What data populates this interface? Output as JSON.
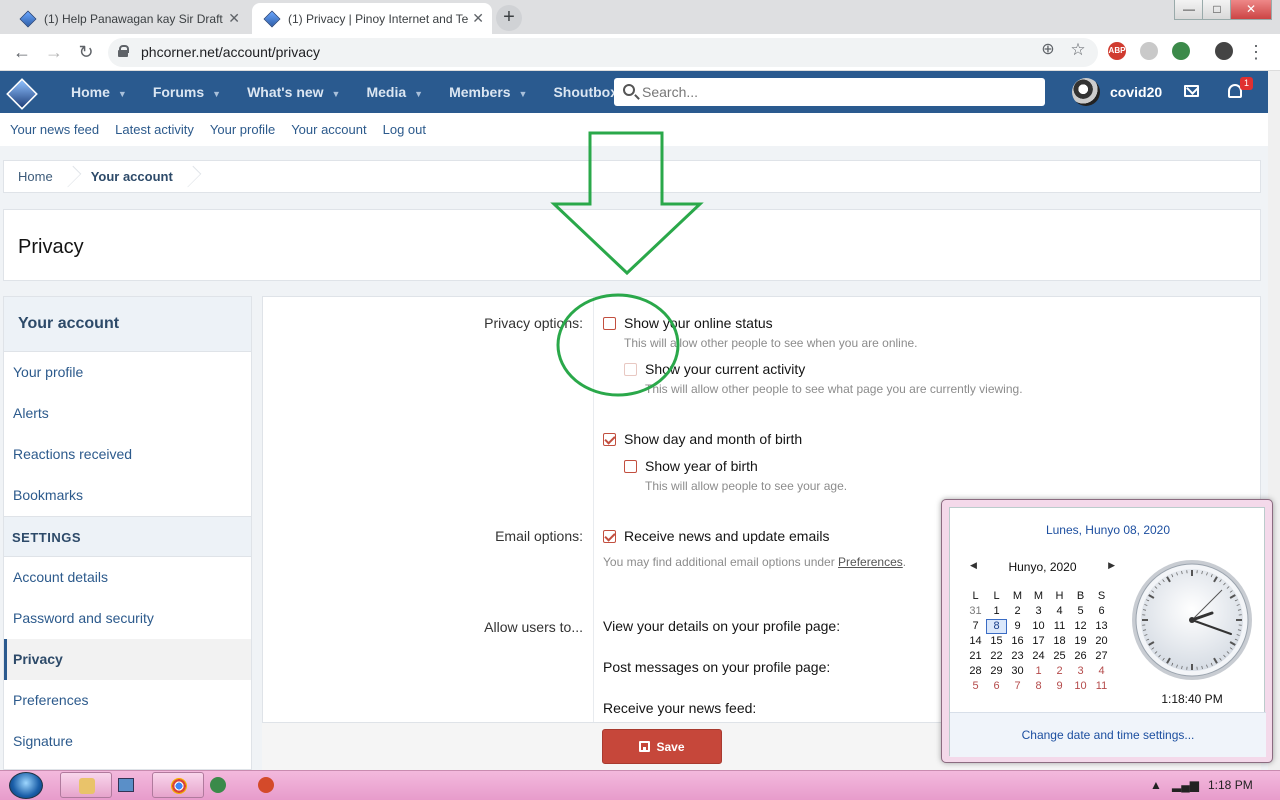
{
  "browser": {
    "tabs": [
      {
        "title": "(1) Help Panawagan kay Sir Draft",
        "active": false
      },
      {
        "title": "(1) Privacy | Pinoy Internet and Te",
        "active": true
      }
    ],
    "new_tab": "+",
    "url": "phcorner.net/account/privacy",
    "window_controls": [
      "—",
      "□",
      "✕"
    ]
  },
  "site": {
    "nav": [
      {
        "label": "Home",
        "dropdown": true
      },
      {
        "label": "Forums",
        "dropdown": true
      },
      {
        "label": "What's new",
        "dropdown": true
      },
      {
        "label": "Media",
        "dropdown": true
      },
      {
        "label": "Members",
        "dropdown": true
      },
      {
        "label": "Shoutbox",
        "dropdown": false
      }
    ],
    "search_placeholder": "Search...",
    "username": "covid20",
    "alert_count": "1",
    "subnav": [
      "Your news feed",
      "Latest activity",
      "Your profile",
      "Your account",
      "Log out"
    ]
  },
  "breadcrumb": [
    "Home",
    "Your account"
  ],
  "page_title": "Privacy",
  "sidebar": {
    "header": "Your account",
    "items_top": [
      "Your profile",
      "Alerts",
      "Reactions received",
      "Bookmarks"
    ],
    "section": "SETTINGS",
    "items_settings": [
      "Account details",
      "Password and security",
      "Privacy",
      "Preferences",
      "Signature"
    ],
    "active": "Privacy"
  },
  "form": {
    "privacy_label": "Privacy options:",
    "online_status": {
      "label": "Show your online status",
      "checked": false,
      "hint": "This will allow other people to see when you are online."
    },
    "current_activity": {
      "label": "Show your current activity",
      "checked": false,
      "hint": "This will allow other people to see what page you are currently viewing."
    },
    "dob": {
      "label": "Show day and month of birth",
      "checked": true
    },
    "year_of_birth": {
      "label": "Show year of birth",
      "checked": false,
      "hint": "This will allow people to see your age."
    },
    "email_label": "Email options:",
    "news_emails": {
      "label": "Receive news and update emails",
      "checked": true,
      "hint_prefix": "You may find additional email options under ",
      "hint_link": "Preferences",
      "hint_suffix": "."
    },
    "allow_label": "Allow users to...",
    "allow_rows": [
      "View your details on your profile page:",
      "Post messages on your profile page:",
      "Receive your news feed:"
    ],
    "save_label": "Save"
  },
  "calendar": {
    "full_date": "Lunes, Hunyo 08, 2020",
    "month": "Hunyo, 2020",
    "weekdays": [
      "L",
      "L",
      "M",
      "M",
      "H",
      "B",
      "S"
    ],
    "weeks": [
      [
        "31",
        "1",
        "2",
        "3",
        "4",
        "5",
        "6"
      ],
      [
        "7",
        "8",
        "9",
        "10",
        "11",
        "12",
        "13"
      ],
      [
        "14",
        "15",
        "16",
        "17",
        "18",
        "19",
        "20"
      ],
      [
        "21",
        "22",
        "23",
        "24",
        "25",
        "26",
        "27"
      ],
      [
        "28",
        "29",
        "30",
        "1",
        "2",
        "3",
        "4"
      ],
      [
        "5",
        "6",
        "7",
        "8",
        "9",
        "10",
        "11"
      ]
    ],
    "today": "8",
    "time": "1:18:40 PM",
    "footer_link": "Change date and time settings..."
  },
  "taskbar": {
    "clock": "1:18 PM"
  },
  "colors": {
    "site_header": "#2a5a8f",
    "checkbox_accent": "#c24f3f",
    "save_button": "#c6473a",
    "annotation_green": "#2aa84a",
    "taskbar": "#e79ccb"
  }
}
